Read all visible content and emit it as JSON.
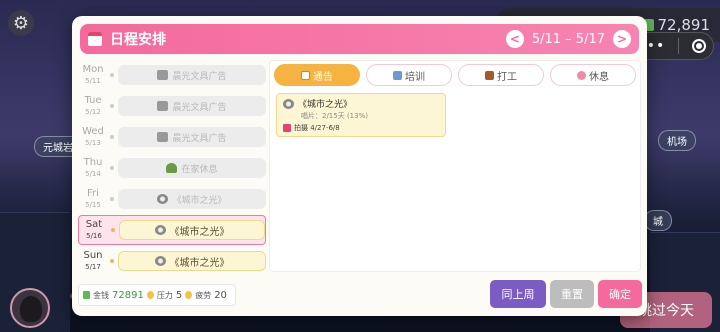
{
  "background": {
    "tags": [
      {
        "text": "元城岩"
      },
      {
        "text": "机场"
      },
      {
        "text": "城"
      }
    ]
  },
  "topbar": {
    "money_value": "72,891",
    "skip_label": "跳过今天"
  },
  "dialog": {
    "title": "日程安排",
    "week_range": "5/11 – 5/17",
    "prev_icon": "<",
    "next_icon": ">",
    "days": [
      {
        "name": "Mon",
        "date": "5/11",
        "activity": "晨光文具广告",
        "icon": "camera-icon",
        "state": "past"
      },
      {
        "name": "Tue",
        "date": "5/12",
        "activity": "晨光文具广告",
        "icon": "camera-icon",
        "state": "past"
      },
      {
        "name": "Wed",
        "date": "5/13",
        "activity": "晨光文具广告",
        "icon": "camera-icon",
        "state": "past"
      },
      {
        "name": "Thu",
        "date": "5/14",
        "activity": "在家休息",
        "icon": "rest-icon",
        "state": "past"
      },
      {
        "name": "Fri",
        "date": "5/15",
        "activity": "《城市之光》",
        "icon": "disc-icon",
        "state": "past"
      },
      {
        "name": "Sat",
        "date": "5/16",
        "activity": "《城市之光》",
        "icon": "disc-icon",
        "state": "active"
      },
      {
        "name": "Sun",
        "date": "5/17",
        "activity": "《城市之光》",
        "icon": "disc-icon",
        "state": "future"
      }
    ],
    "tabs": [
      {
        "label": "通告",
        "icon": "clipboard-icon",
        "active": true
      },
      {
        "label": "培训",
        "icon": "book-icon",
        "active": false
      },
      {
        "label": "打工",
        "icon": "briefcase-icon",
        "active": false
      },
      {
        "label": "休息",
        "icon": "flower-icon",
        "active": false
      }
    ],
    "card": {
      "title": "《城市之光》",
      "subtitle": "唱片：2/15天 (13%)",
      "period": "拍摄 4/27-6/8"
    },
    "stats": {
      "money_label": "金钱",
      "money_value": "72891",
      "stress_label": "压力",
      "stress_value": "5",
      "fatigue_label": "疲劳",
      "fatigue_value": "20"
    },
    "buttons": {
      "last_week": "同上周",
      "reset": "重置",
      "confirm": "确定"
    }
  }
}
